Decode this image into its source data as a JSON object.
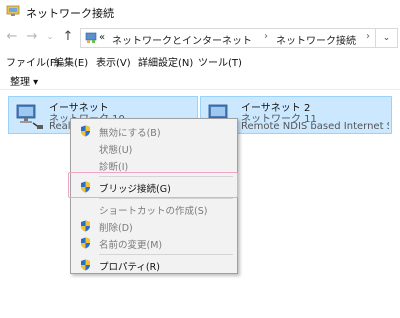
{
  "window": {
    "title": "ネットワーク接続"
  },
  "address": {
    "overflow": "«",
    "crumbs": [
      "ネットワークとインターネット",
      "ネットワーク接続"
    ]
  },
  "menubar": {
    "items": [
      "ファイル(F)",
      "編集(E)",
      "表示(V)",
      "詳細設定(N)",
      "ツール(T)"
    ]
  },
  "commandbar": {
    "organize": "整理 ▾"
  },
  "adapters": [
    {
      "name": "イーサネット",
      "network": "ネットワーク 10",
      "device": "Realt"
    },
    {
      "name": "イーサネット 2",
      "network": "ネットワーク 11",
      "device": "Remote NDIS based Internet Shari..."
    }
  ],
  "context_menu": {
    "items": [
      {
        "label": "無効にする(B)",
        "shield": true,
        "enabled": false
      },
      {
        "label": "状態(U)",
        "shield": false,
        "enabled": false
      },
      {
        "label": "診断(I)",
        "shield": false,
        "enabled": false
      },
      {
        "label": "ブリッジ接続(G)",
        "shield": true,
        "enabled": true
      },
      {
        "label": "ショートカットの作成(S)",
        "shield": false,
        "enabled": false
      },
      {
        "label": "削除(D)",
        "shield": true,
        "enabled": false
      },
      {
        "label": "名前の変更(M)",
        "shield": true,
        "enabled": false
      },
      {
        "label": "プロパティ(R)",
        "shield": true,
        "enabled": true
      }
    ]
  },
  "colors": {
    "selection": "#cce8ff",
    "highlight": "#f0a7c6",
    "menu_bg": "#f2f2f2"
  }
}
